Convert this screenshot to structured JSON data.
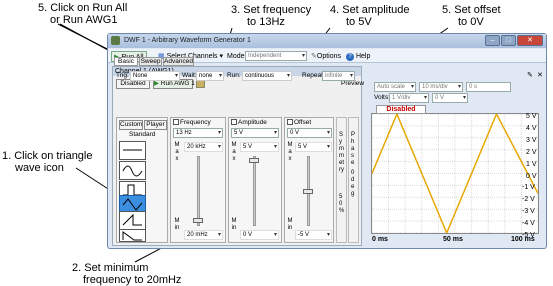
{
  "annotations": {
    "a5a_line1": "5. Click on Run All",
    "a5a_line2": "or Run AWG1",
    "a3_line1": "3. Set frequency",
    "a3_line2": "to 13Hz",
    "a4_line1": "4. Set amplitude",
    "a4_line2": "to 5V",
    "a5b_line1": "5. Set offset",
    "a5b_line2": "to 0V",
    "a1_line1": "1.  Click on triangle",
    "a1_line2": "wave icon",
    "a2_line1": "2. Set minimum",
    "a2_line2": "frequency to 20mHz"
  },
  "window": {
    "title": "DWF 1 - Arbitrary Waveform Generator 1"
  },
  "toolbar": {
    "run_all": "Run All",
    "select_channels": "Select Channels",
    "mode_label": "Mode:",
    "mode_value": "Independent",
    "options": "Options",
    "help": "Help"
  },
  "channel": {
    "header": "Channel 1 (AWG1)",
    "disabled_btn": "Disabled",
    "run_btn": "Run AWG 1",
    "preview": "Preview",
    "tabs": [
      "Basic",
      "Sweep",
      "Advanced"
    ],
    "trig_label": "Trig:",
    "trig_value": "None",
    "wait_label": "Wait:",
    "wait_value": "none",
    "run_label": "Run:",
    "run_value": "continuous",
    "repeat_label": "Repeat:",
    "repeat_value": "infinite",
    "shape_tabs": [
      "Custom",
      "Player"
    ],
    "standard": "Standard",
    "frequency": {
      "label": "Frequency",
      "value": "13 Hz",
      "max": "20 kHz",
      "min": "20 mHz"
    },
    "amplitude": {
      "label": "Amplitude",
      "value": "5 V",
      "max": "5 V",
      "min": "0 V"
    },
    "offset": {
      "label": "Offset",
      "value": "0 V",
      "max": "5 V",
      "min": "-5 V"
    },
    "max_label": "Max",
    "min_label": "Min",
    "symmetry": {
      "label": "Symmetry",
      "value": "50 %"
    },
    "phase": {
      "label": "Phase",
      "value": "0 deg"
    }
  },
  "plot_controls": {
    "autoscale": "Auto scale",
    "time_div": "10 ms/div",
    "time_offset": "0 s",
    "volts_label": "Volts:",
    "volts_div": "1 V/div",
    "volts_offset": "0 V"
  },
  "plot": {
    "disabled_label": "Disabled"
  },
  "chart_data": {
    "type": "line",
    "x": [
      0,
      15,
      45,
      75,
      100
    ],
    "y": [
      0,
      5,
      -5,
      5,
      -1.67
    ],
    "xlim": [
      0,
      100
    ],
    "ylim": [
      -5,
      5
    ],
    "y_ticks": [
      "5 V",
      "4 V",
      "3 V",
      "2 V",
      "1 V",
      "0 V",
      "-1 V",
      "-2 V",
      "-3 V",
      "-4 V",
      "-5 V"
    ],
    "x_ticks": [
      "0 ms",
      "50 ms",
      "100 ms"
    ],
    "grid": true,
    "line_color": "#e8a800"
  }
}
